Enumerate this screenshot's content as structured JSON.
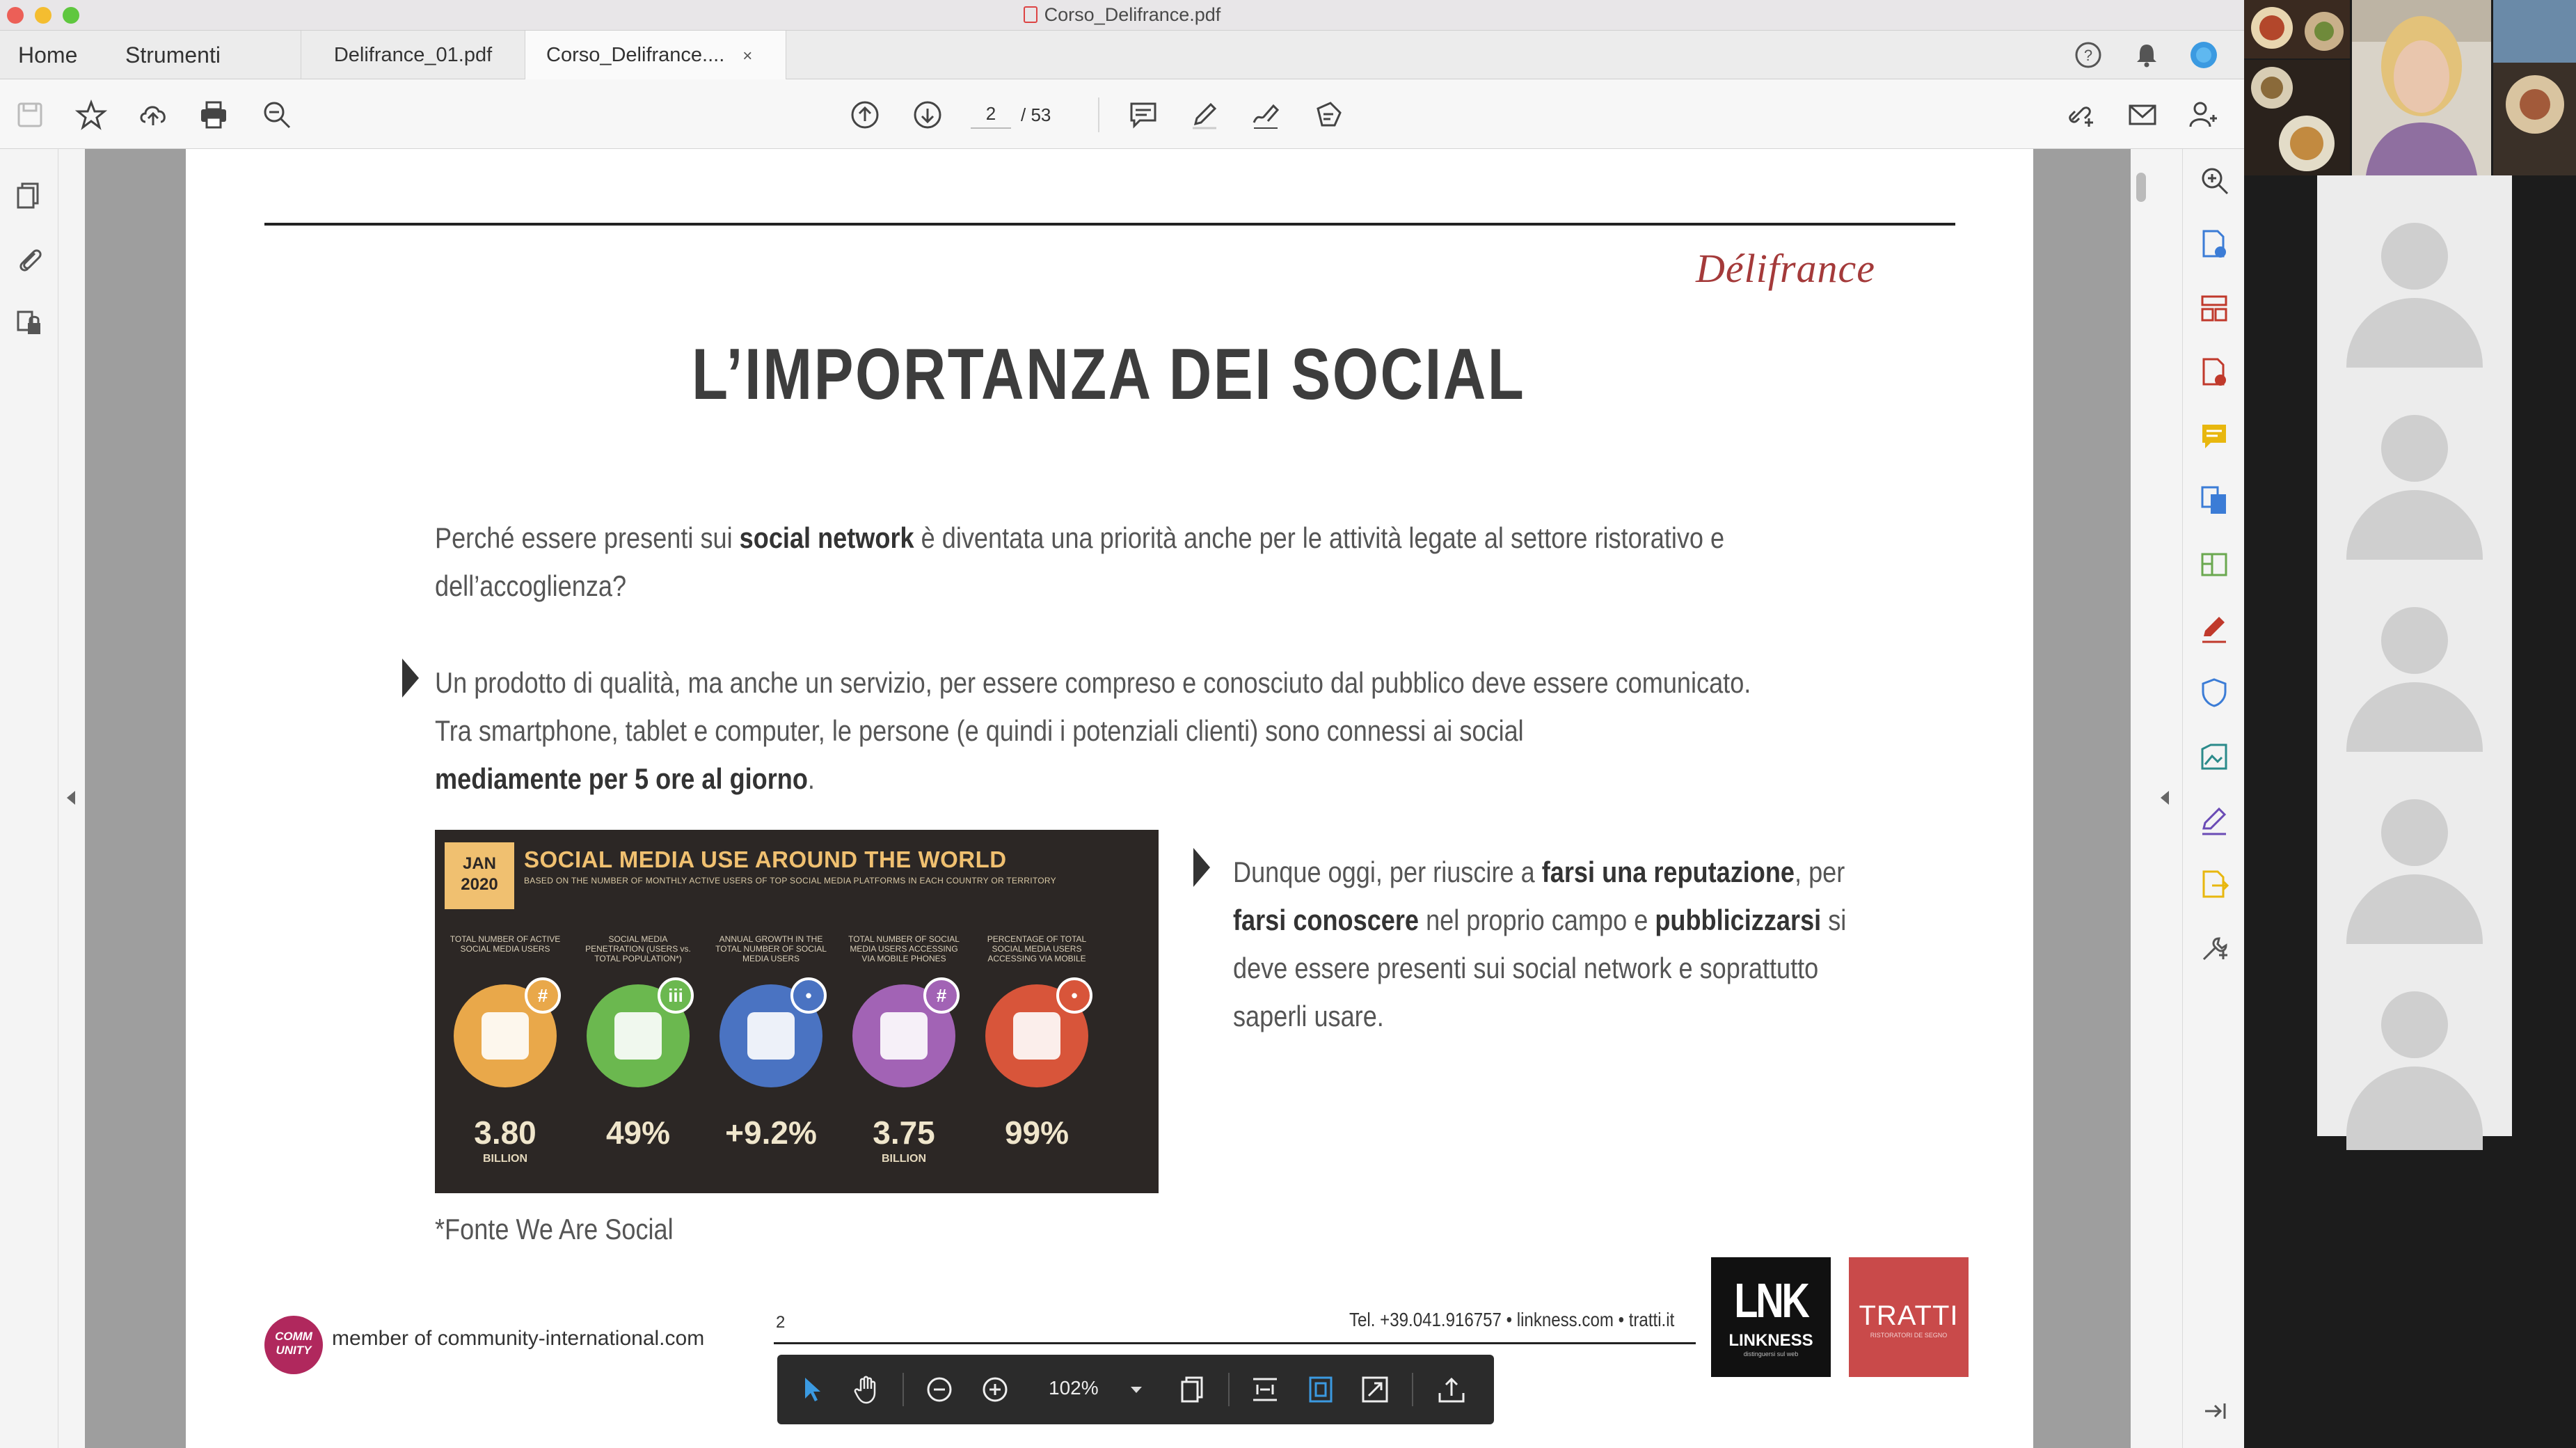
{
  "window": {
    "title": "Corso_Delifrance.pdf"
  },
  "tabs": {
    "home": "Home",
    "tools": "Strumenti",
    "docs": [
      {
        "label": "Delifrance_01.pdf"
      },
      {
        "label": "Corso_Delifrance....",
        "close": "×"
      }
    ]
  },
  "toolbar": {
    "page_current": "2",
    "page_total": "/ 53"
  },
  "page": {
    "brand": "Délifrance",
    "heading": "L’IMPORTANZA DEI SOCIAL",
    "intro_1": "Perché essere presenti sui ",
    "intro_1_bold": "social network",
    "intro_1_end": " è diventata una priorità anche per le attività legate al settore ristorativo e",
    "intro_2": "dell’accoglienza?",
    "bullet1_line1": "Un prodotto di qualità, ma anche un servizio, per essere compreso e conosciuto dal pubblico deve essere comunicato.",
    "bullet1_line2": "Tra smartphone, tablet e computer, le persone (e quindi i potenziali clienti) sono connessi ai social",
    "bullet1_line3_bold": "mediamente per 5 ore al giorno",
    "bullet1_line3_end": ".",
    "bullet2_l1_a": "Dunque oggi, per riuscire a ",
    "bullet2_l1_b": "farsi una reputazione",
    "bullet2_l1_c": ", per",
    "bullet2_l2_a": "farsi conoscere",
    "bullet2_l2_b": " nel proprio campo e ",
    "bullet2_l2_c": "pubblicizzarsi",
    "bullet2_l2_d": " si",
    "bullet2_l3": "deve essere presenti sui social network e soprattutto",
    "bullet2_l4": "saperli usare.",
    "source": "*Fonte We Are Social",
    "footer": {
      "community_logo": "COMM UNITY",
      "community": "member of community-international.com",
      "page_number": "2",
      "contact": "Tel. +39.041.916757 • linkness.com • tratti.it",
      "lnk_logo": "LNK",
      "lnk_name": "LINKNESS",
      "lnk_tag": "distinguersi sul web",
      "tratti_logo": "TRATTI",
      "tratti_tag": "RISTORATORI DE SEGNO"
    },
    "infographic": {
      "date": "JAN 2020",
      "title": "SOCIAL MEDIA USE AROUND THE WORLD",
      "subtitle": "BASED ON THE NUMBER OF MONTHLY ACTIVE USERS OF TOP SOCIAL MEDIA PLATFORMS IN EACH COUNTRY OR TERRITORY",
      "metrics": [
        {
          "label": "TOTAL NUMBER OF ACTIVE SOCIAL MEDIA USERS",
          "value": "3.80",
          "unit": "BILLION",
          "badge": "#",
          "color": "#e9a84a"
        },
        {
          "label": "SOCIAL MEDIA PENETRATION (USERS vs. TOTAL POPULATION*)",
          "value": "49%",
          "unit": "",
          "badge": "iii",
          "color": "#6bb84f"
        },
        {
          "label": "ANNUAL GROWTH IN THE TOTAL NUMBER OF SOCIAL MEDIA USERS",
          "value": "+9.2%",
          "unit": "",
          "badge": "•",
          "color": "#4a73c2"
        },
        {
          "label": "TOTAL NUMBER OF SOCIAL MEDIA USERS ACCESSING VIA MOBILE PHONES",
          "value": "3.75",
          "unit": "BILLION",
          "badge": "#",
          "color": "#a263b5"
        },
        {
          "label": "PERCENTAGE OF TOTAL SOCIAL MEDIA USERS ACCESSING VIA MOBILE",
          "value": "99%",
          "unit": "",
          "badge": "•",
          "color": "#d8553a"
        }
      ]
    }
  },
  "floating_toolbar": {
    "zoom": "102%"
  },
  "icons": {
    "toolbar": [
      "save-icon",
      "star-icon",
      "upload-icon",
      "print-icon",
      "zoom-out-icon",
      "page-up-icon",
      "page-down-icon",
      "comment-icon",
      "pen-icon",
      "sign-icon",
      "stamp-icon",
      "share-link-icon",
      "mail-icon",
      "add-user-icon"
    ],
    "left_rail": [
      "pages-icon",
      "attachment-icon",
      "lock-pages-icon"
    ],
    "right_rail": [
      "search-zoom-icon",
      "export-pdf-icon",
      "organize-icon",
      "create-pdf-icon",
      "comment-note-icon",
      "combine-icon",
      "compress-icon",
      "fill-sign-icon",
      "protect-icon",
      "edit-image-icon",
      "signature-icon",
      "send-icon",
      "tools-icon",
      "expand-panel-icon"
    ]
  },
  "colors": {
    "brand": "#a43a3a",
    "accent_blue": "#3b7cd6",
    "rail_red": "#c0392b"
  },
  "video_call": {
    "participants_visible": 8
  }
}
